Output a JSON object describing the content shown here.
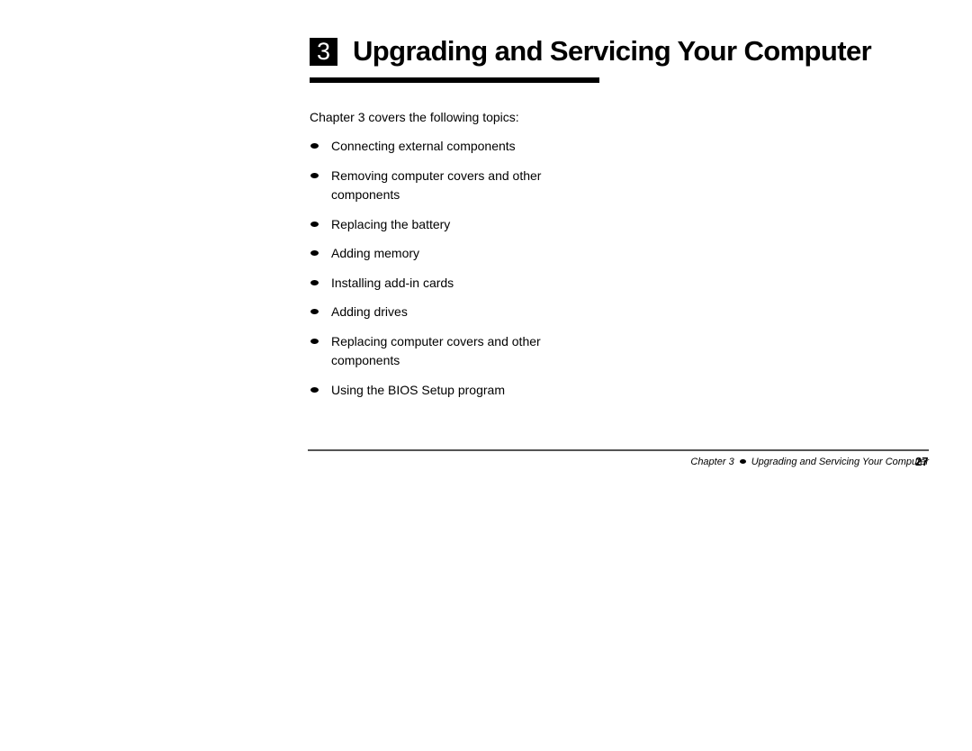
{
  "chapter": {
    "number": "3",
    "title": "Upgrading and Servicing Your Computer"
  },
  "intro": "Chapter 3 covers the following topics:",
  "topics": [
    "Connecting external components",
    "Removing computer covers and other components",
    "Replacing the battery",
    "Adding memory",
    "Installing add-in cards",
    "Adding drives",
    "Replacing computer covers and other components",
    "Using the BIOS Setup program"
  ],
  "footer": {
    "chapter_label": "Chapter 3",
    "section_title": "Upgrading and Servicing Your Computer",
    "page_number": "27"
  }
}
